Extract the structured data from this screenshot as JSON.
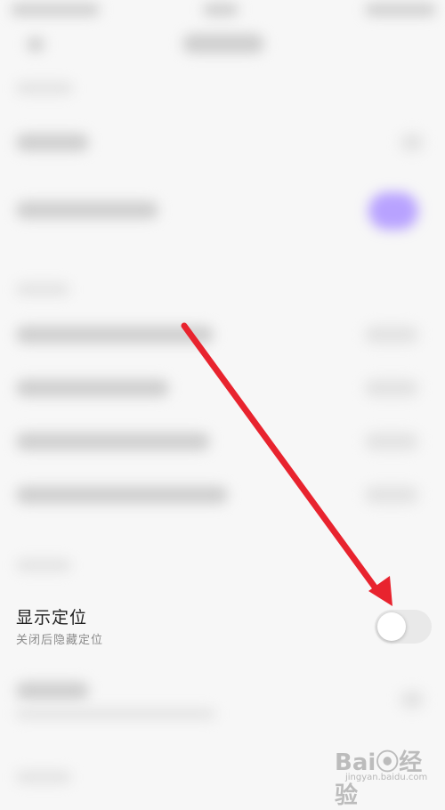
{
  "settings": {
    "show_location": {
      "title": "显示定位",
      "subtitle": "关闭后隐藏定位",
      "enabled": false
    }
  },
  "colors": {
    "arrow": "#e8232e",
    "toggle_off": "#e9e9e9",
    "blurred_toggle_on": "#a78bfa"
  },
  "watermark": {
    "brand": "Bai⦿经验",
    "domain": "jingyan.baidu.com"
  }
}
